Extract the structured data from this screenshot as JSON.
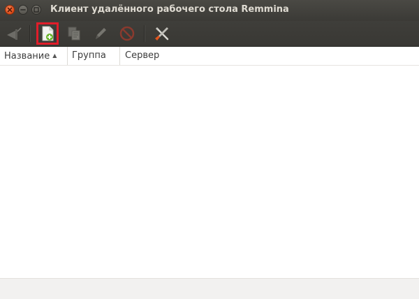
{
  "window": {
    "title": "Клиент удалённого рабочего стола Remmina"
  },
  "toolbar": {
    "icons": [
      "connect-icon",
      "new-file-icon",
      "copy-icon",
      "edit-pencil-icon",
      "delete-icon",
      "preferences-tools-icon"
    ]
  },
  "columns": {
    "name": "Название",
    "group": "Группа",
    "server": "Сервер",
    "sort_indicator": "▲"
  },
  "colors": {
    "titlebar": "#3b3a36",
    "toolbar": "#3c3b37",
    "highlight": "#e11d2a",
    "close_button": "#df4a16"
  }
}
